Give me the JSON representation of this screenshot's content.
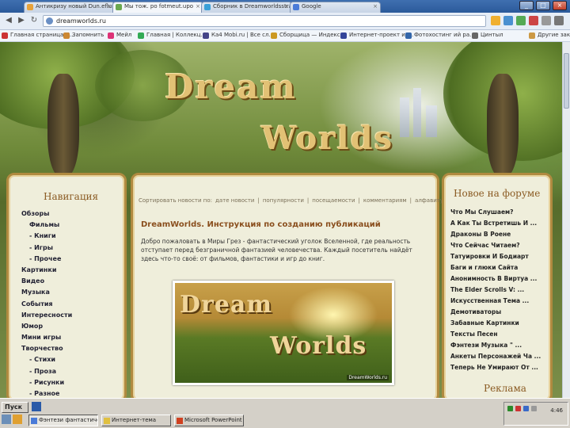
{
  "browser": {
    "tabs": [
      {
        "label": "Антикризу новый Dun.eflum",
        "color": "#e8a23a",
        "active": false
      },
      {
        "label": "Мы тож. ро fotmeut.upo",
        "color": "#6aa84f",
        "active": true
      },
      {
        "label": "Сборник в Dreamworldsstrahin",
        "color": "#3aa0d8",
        "active": false
      },
      {
        "label": "Google",
        "color": "#4a7bd8",
        "active": false
      }
    ],
    "url": "dreamworlds.ru",
    "bookmarks": [
      {
        "label": "Главная страница И...",
        "color": "#cc3333"
      },
      {
        "label": "Запомнить",
        "color": "#cc8833"
      },
      {
        "label": "Мейл",
        "color": "#dd3377"
      },
      {
        "label": "Главная | Коллекц...",
        "color": "#33aa55"
      },
      {
        "label": "Ка4 Mobi.ru | Bce сл...",
        "color": "#444488"
      },
      {
        "label": "Сборщица — Индекс...",
        "color": "#cc9922"
      },
      {
        "label": "Интернет-проект из...",
        "color": "#334499"
      },
      {
        "label": "Фотохостинг ий ра...",
        "color": "#3366aa"
      },
      {
        "label": "Цинтыл",
        "color": "#666666"
      },
      {
        "label": "Другие закладки",
        "color": "#cc9944"
      }
    ]
  },
  "site": {
    "logo_line1": "Dream",
    "logo_line2": "Worlds",
    "nav": {
      "title": "Навигация",
      "items": [
        {
          "label": "Обзоры",
          "sub": false
        },
        {
          "label": "Фильмы",
          "sub": true
        },
        {
          "label": "- Книги",
          "sub": true
        },
        {
          "label": "- Игры",
          "sub": true
        },
        {
          "label": "- Прочее",
          "sub": true
        },
        {
          "label": "Картинки",
          "sub": false
        },
        {
          "label": "Видео",
          "sub": false
        },
        {
          "label": "Музыка",
          "sub": false
        },
        {
          "label": "События",
          "sub": false
        },
        {
          "label": "Интересности",
          "sub": false
        },
        {
          "label": "Юмор",
          "sub": false
        },
        {
          "label": "Мини игры",
          "sub": false
        },
        {
          "label": "Творчество",
          "sub": false
        },
        {
          "label": "- Стихи",
          "sub": true
        },
        {
          "label": "- Проза",
          "sub": true
        },
        {
          "label": "- Рисунки",
          "sub": true
        },
        {
          "label": "- Разное",
          "sub": true
        }
      ]
    },
    "main": {
      "breadcrumbs": [
        "Сортировать новости по:",
        "дате новости",
        "|",
        "популярности",
        "|",
        "посещаемости",
        "|",
        "комментариям",
        "|",
        "алфавиту"
      ],
      "article_title": "DreamWorlds. Инструкция по созданию публикаций",
      "article_body": "Добро пожаловать в Миры Грез - фантастический уголок Вселенной, где реальность отступает перед безграничной фантазией человечества. Каждый посетитель найдёт здесь что-то своё: от фильмов, фантастики и игр до книг.",
      "image_logo1": "Dream",
      "image_logo2": "Worlds",
      "image_caption": "DreamWorlds.ru"
    },
    "forum": {
      "title": "Новое на форуме",
      "items": [
        "Что Мы Слушаем?",
        "А Как Ты Встретишь И ...",
        "Драконы В Роене",
        "Что Сейчас Читаем?",
        "Татуировки И Бодиарт",
        "Баги и глюки Сайта",
        "Анонимность В Виртуа ...",
        "The Elder Scrolls V: ...",
        "Искусственная Тема ...",
        "Демотиваторы",
        "Забавные Картинки",
        "Тексты Песен",
        "Фэнтези Музыка \" ...",
        "Анкеты Персонажей Ча ...",
        "Теперь Не Умирают От ..."
      ],
      "ad_title": "Реклама"
    }
  },
  "taskbar": {
    "start_label": "Пуск",
    "buttons": [
      {
        "label": "Фэнтези фантастичес...",
        "active": true,
        "color": "#4a7bd8"
      },
      {
        "label": "Интернет-тема",
        "active": false,
        "color": "#e0c040"
      },
      {
        "label": "Microsoft PowerPoint - [...",
        "active": false,
        "color": "#d04020"
      }
    ],
    "clock": "4:46"
  }
}
